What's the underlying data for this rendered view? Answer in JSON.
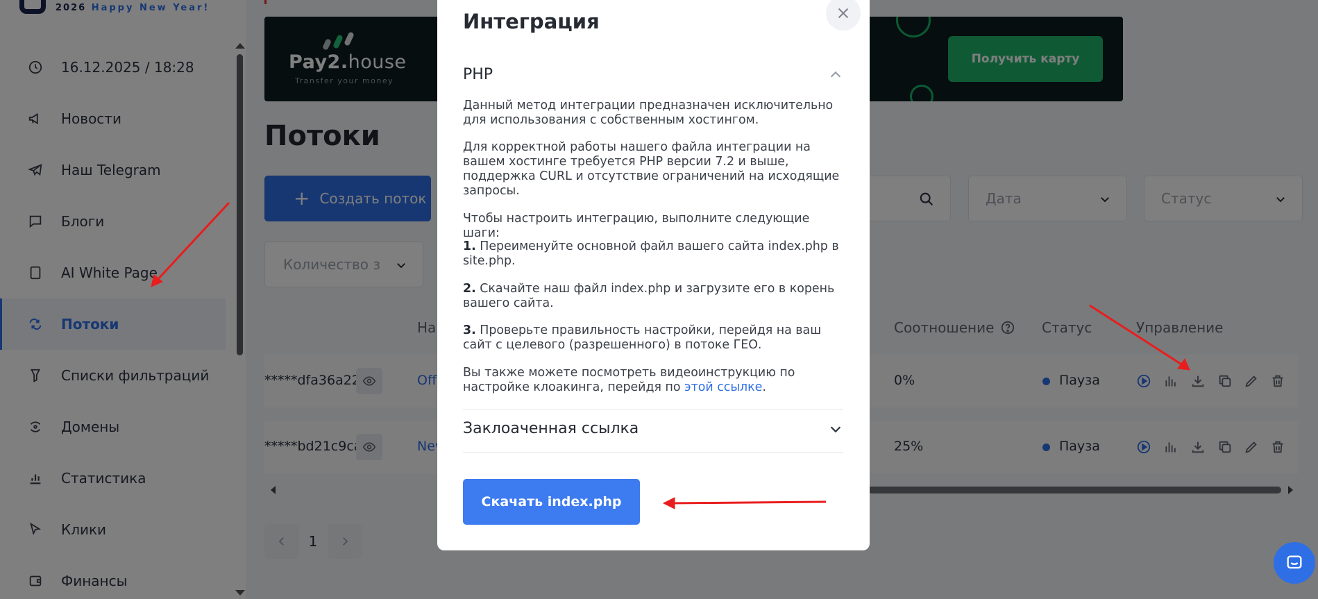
{
  "brand": {
    "tagline_year": "2026",
    "tagline_text": "Happy New Year!"
  },
  "sidebar": {
    "items": [
      {
        "label": "16.12.2025 / 18:28",
        "icon": "clock-icon"
      },
      {
        "label": "Новости",
        "icon": "megaphone-icon"
      },
      {
        "label": "Наш Telegram",
        "icon": "telegram-icon"
      },
      {
        "label": "Блоги",
        "icon": "chat-icon"
      },
      {
        "label": "AI White Page",
        "icon": "page-icon"
      },
      {
        "label": "Потоки",
        "icon": "flows-icon",
        "active": true
      },
      {
        "label": "Списки фильтраций",
        "icon": "filter-icon"
      },
      {
        "label": "Домены",
        "icon": "domains-icon"
      },
      {
        "label": "Статистика",
        "icon": "stats-icon"
      },
      {
        "label": "Клики",
        "icon": "cursor-icon"
      },
      {
        "label": "Финансы",
        "icon": "wallet-icon"
      }
    ]
  },
  "banner": {
    "brand": "Pay2.house",
    "brand_a": "Pay2.",
    "brand_b": "house",
    "subtitle": "Transfer your money",
    "cta": "Получить карту"
  },
  "main": {
    "title": "Потоки",
    "create_button": "Создать поток",
    "date_select": "Дата",
    "status_select": "Статус",
    "quantity_select": "Количество з",
    "columns": {
      "name": "На",
      "ratio": "Соотношение",
      "status": "Статус",
      "manage": "Управление"
    },
    "rows": [
      {
        "id": "*****dfa36a22",
        "name": "Off",
        "ratio": "0%",
        "status": "Пауза"
      },
      {
        "id": "*****bd21c9ca",
        "name": "Nev",
        "ratio": "25%",
        "status": "Пауза"
      }
    ],
    "pagination": {
      "current": "1"
    }
  },
  "modal": {
    "title": "Интеграция",
    "section_php": "PHP",
    "p1": "Данный метод интеграции предназначен исключительно для использования с собственным хостингом.",
    "p2": "Для корректной работы нашего файла интеграции на вашем хостинге требуется PHP версии 7.2 и выше, поддержка CURL и отсутствие ограничений на исходящие запросы.",
    "p3": "Чтобы настроить интеграцию, выполните следующие шаги:",
    "step1_num": "1.",
    "step1": "Переименуйте основной файл вашего сайта index.php в site.php.",
    "step2_num": "2.",
    "step2": "Скачайте наш файл index.php и загрузите его в корень вашего сайта.",
    "step3_num": "3.",
    "step3": "Проверьте правильность настройки, перейдя на ваш сайт с целевого (разрешенного) в потоке ГЕО.",
    "p4_before": "Вы также можете посмотреть видеоинструкцию по настройке клоакинга, перейдя по",
    "p4_link": "этой ссылке",
    "p4_after": ".",
    "section_cloaked": "Заклоаченная ссылка",
    "download_button": "Скачать index.php"
  },
  "colors": {
    "accent": "#2f6fe6",
    "banner_cta": "#1fb56b",
    "annotation_arrow": "#e81d1d"
  }
}
